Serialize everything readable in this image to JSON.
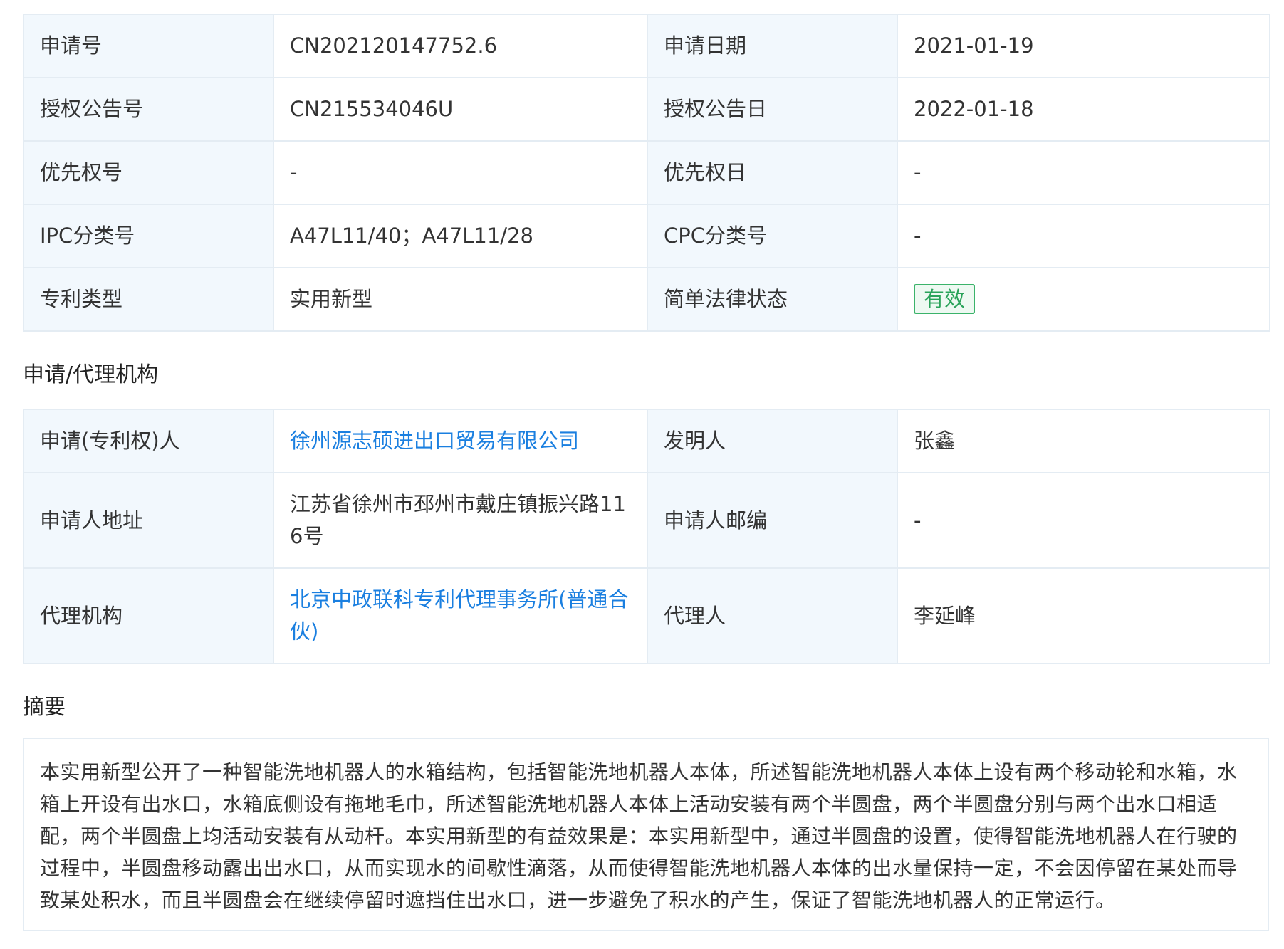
{
  "basic_info": {
    "rows": [
      {
        "label1": "申请号",
        "value1": "CN202120147752.6",
        "label2": "申请日期",
        "value2": "2021-01-19"
      },
      {
        "label1": "授权公告号",
        "value1": "CN215534046U",
        "label2": "授权公告日",
        "value2": "2022-01-18"
      },
      {
        "label1": "优先权号",
        "value1": "-",
        "label2": "优先权日",
        "value2": "-"
      },
      {
        "label1": "IPC分类号",
        "value1": "A47L11/40；A47L11/28",
        "label2": "CPC分类号",
        "value2": "-"
      },
      {
        "label1": "专利类型",
        "value1": "实用新型",
        "label2": "简单法律状态",
        "value2": "有效"
      }
    ]
  },
  "agency": {
    "title": "申请/代理机构",
    "rows": [
      {
        "label1": "申请(专利权)人",
        "value1": "徐州源志硕进出口贸易有限公司",
        "label2": "发明人",
        "value2": "张鑫"
      },
      {
        "label1": "申请人地址",
        "value1": "江苏省徐州市邳州市戴庄镇振兴路116号",
        "label2": "申请人邮编",
        "value2": "-"
      },
      {
        "label1": "代理机构",
        "value1": "北京中政联科专利代理事务所(普通合伙)",
        "label2": "代理人",
        "value2": "李延峰"
      }
    ]
  },
  "abstract": {
    "title": "摘要",
    "text": "本实用新型公开了一种智能洗地机器人的水箱结构，包括智能洗地机器人本体，所述智能洗地机器人本体上设有两个移动轮和水箱，水箱上开设有出水口，水箱底侧设有拖地毛巾，所述智能洗地机器人本体上活动安装有两个半圆盘，两个半圆盘分别与两个出水口相适配，两个半圆盘上均活动安装有从动杆。本实用新型的有益效果是：本实用新型中，通过半圆盘的设置，使得智能洗地机器人在行驶的过程中，半圆盘移动露出出水口，从而实现水的间歇性滴落，从而使得智能洗地机器人本体的出水量保持一定，不会因停留在某处而导致某处积水，而且半圆盘会在继续停留时遮挡住出水口，进一步避免了积水的产生，保证了智能洗地机器人的正常运行。"
  },
  "colors": {
    "label_bg": "#f2f8fd",
    "border": "#e4ecf3",
    "link": "#1a7fe0",
    "status_green": "#2aa35a"
  }
}
